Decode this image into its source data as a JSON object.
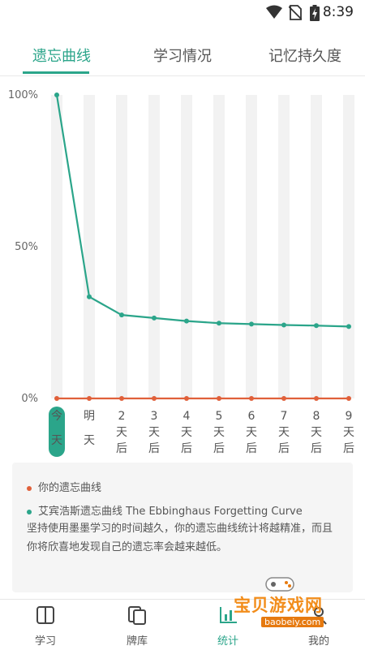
{
  "status_bar": {
    "time": "8:39"
  },
  "tabs": [
    {
      "label": "遗忘曲线",
      "active": true
    },
    {
      "label": "学习情况",
      "active": false
    },
    {
      "label": "记忆持久度",
      "active": false
    }
  ],
  "chart_data": {
    "type": "line",
    "y_tick_labels": [
      "100%",
      "50%",
      "0%"
    ],
    "ylim": [
      0,
      100
    ],
    "categories": [
      "今天",
      "明天",
      "2天后",
      "3天后",
      "4天后",
      "5天后",
      "6天后",
      "7天后",
      "8天后",
      "9天后"
    ],
    "series": [
      {
        "name": "艾宾浩斯遗忘曲线 The Ebbinghaus Forgetting Curve",
        "color": "#2ba58a",
        "values": [
          100,
          33.5,
          27.5,
          26.5,
          25.5,
          24.8,
          24.5,
          24.2,
          24,
          23.7
        ]
      },
      {
        "name": "你的遗忘曲线",
        "color": "#e0603a",
        "values": [
          0,
          0,
          0,
          0,
          0,
          0,
          0,
          0,
          0,
          0
        ]
      }
    ],
    "highlight_category": "今天",
    "grid": "vertical bands"
  },
  "legend": {
    "mine": "你的遗忘曲线",
    "ebbinghaus": "艾宾浩斯遗忘曲线 The Ebbinghaus Forgetting Curve",
    "description": "坚持使用墨墨学习的时间越久，你的遗忘曲线统计将越精准，而且你将欣喜地发现自己的遗忘率会越来越低。"
  },
  "bottom_nav": [
    {
      "label": "学习",
      "icon": "book-icon",
      "active": false
    },
    {
      "label": "牌库",
      "icon": "cards-icon",
      "active": false
    },
    {
      "label": "统计",
      "icon": "chart-icon",
      "active": true
    },
    {
      "label": "我的",
      "icon": "person-icon",
      "active": false
    }
  ],
  "watermark": {
    "title": "宝贝游戏网",
    "url": "baobeiy.com"
  },
  "colors": {
    "accent": "#2ba58a",
    "mine": "#e0603a",
    "band": "#f2f2f2"
  }
}
